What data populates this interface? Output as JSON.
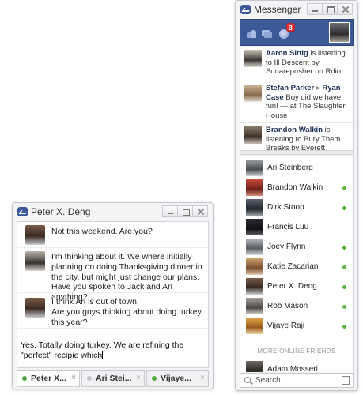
{
  "chat": {
    "title": "Peter X. Deng",
    "messages": [
      {
        "lines": [
          "Not this weekend. Are you?"
        ]
      },
      {
        "lines": [
          "I'm thinking about it. We where initially planning on doing Thanksgiving dinner in the city, but might just change our plans.",
          "Have you spoken to Jack and Ari anything?"
        ]
      },
      {
        "lines": [
          "I think Ari is out of town.",
          "Are you guys thinking about doing turkey this year?"
        ]
      }
    ],
    "compose_text": "Yes. Totally doing turkey. We are refining the \"perfect\" recipie which",
    "tabs": [
      {
        "label": "Peter X...",
        "close": "×"
      },
      {
        "label": "Ari Stei...",
        "close": "×"
      },
      {
        "label": "Vijaye...",
        "close": "×"
      }
    ]
  },
  "messenger": {
    "title": "Messenger",
    "notification_count": "3",
    "ticker": [
      {
        "name": "Aaron Sittig",
        "text": " is listening to Ill Descent by Squarepusher on Rdio."
      },
      {
        "name": "Stefan Parker",
        "arrow": " ▸ ",
        "name2": "Ryan Case",
        "text": " Boy did we have fun! — at The Slaughter House"
      },
      {
        "name": "Brandon Walkin",
        "text": " is listening to Bury Them Breaks by Everett"
      }
    ],
    "buddies": [
      {
        "name": "Ari Steinberg",
        "online": false
      },
      {
        "name": "Brandon Walkin",
        "online": true
      },
      {
        "name": "Dirk Stoop",
        "online": true
      },
      {
        "name": "Francis Luu",
        "online": false
      },
      {
        "name": "Joey Flynn",
        "online": true
      },
      {
        "name": "Katie Zacarian",
        "online": true
      },
      {
        "name": "Peter X. Deng",
        "online": true
      },
      {
        "name": "Rob Mason",
        "online": true
      },
      {
        "name": "Vijaye Raji",
        "online": true
      }
    ],
    "more_online_label": "MORE ONLINE FRIENDS",
    "more_buddies": [
      {
        "name": "Adam Mosseri",
        "online": false
      }
    ],
    "search_label": "Search"
  },
  "colors": {
    "facebook_blue": "#3d5a98",
    "online_green": "#5cb53f",
    "badge_red": "#e0363b"
  }
}
